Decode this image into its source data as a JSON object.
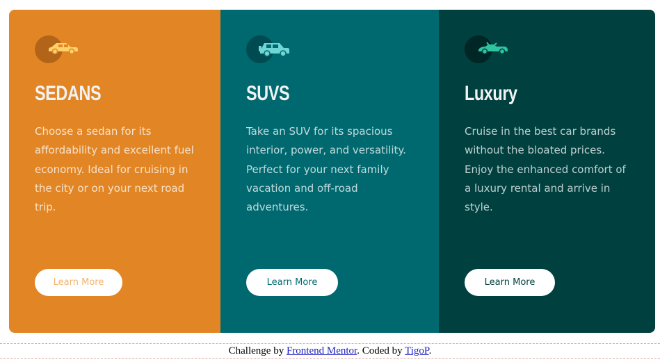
{
  "cards": [
    {
      "icon": "sedan-car-icon",
      "title": "SEDANS",
      "description": "Choose a sedan for its affordability and excellent fuel economy. Ideal for cruising in the city or on your next road trip.",
      "button_label": "Learn More",
      "background_color": "#e28625"
    },
    {
      "icon": "suv-car-icon",
      "title": "SUVS",
      "description": "Take an SUV for its spacious interior, power, and versatility. Perfect for your next family vacation and off-road adventures.",
      "button_label": "Learn More",
      "background_color": "#006970"
    },
    {
      "icon": "luxury-car-icon",
      "title": "Luxury",
      "description": "Cruise in the best car brands without the bloated prices. Enjoy the enhanced comfort of a luxury rental and arrive in style.",
      "button_label": "Learn More",
      "background_color": "#004140"
    }
  ],
  "attribution": {
    "prefix": "Challenge by ",
    "challenge_link": "Frontend Mentor",
    "middle": ". Coded by ",
    "author_link": "TigoP",
    "suffix": "."
  }
}
